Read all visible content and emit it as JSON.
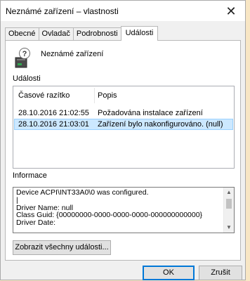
{
  "window": {
    "title": "Neznámé zařízení – vlastnosti",
    "close_glyph": "✕"
  },
  "tabs": [
    {
      "label": "Obecné",
      "active": false
    },
    {
      "label": "Ovladač",
      "active": false
    },
    {
      "label": "Podrobnosti",
      "active": false
    },
    {
      "label": "Události",
      "active": true
    }
  ],
  "device": {
    "icon": "unknown-device-icon",
    "name": "Neznámé zařízení"
  },
  "events": {
    "section_label": "Události",
    "columns": [
      "Časové razítko",
      "Popis"
    ],
    "rows": [
      {
        "timestamp": "28.10.2016 21:02:55",
        "description": "Požadována instalace zařízení",
        "selected": false
      },
      {
        "timestamp": "28.10.2016 21:03:01",
        "description": "Zařízení bylo nakonfigurováno. (null)",
        "selected": true
      }
    ]
  },
  "info": {
    "section_label": "Informace",
    "lines": [
      "Device ACPI\\INT33A0\\0 was configured.",
      "",
      "Driver Name: null",
      "Class Guid: {00000000-0000-0000-0000-000000000000}",
      "Driver Date:"
    ]
  },
  "buttons": {
    "show_all": "Zobrazit všechny události...",
    "ok": "OK",
    "cancel": "Zrušit"
  },
  "colors": {
    "selection_bg": "#cce8ff",
    "selection_border": "#99d1ff",
    "default_button_border": "#0078d7"
  }
}
